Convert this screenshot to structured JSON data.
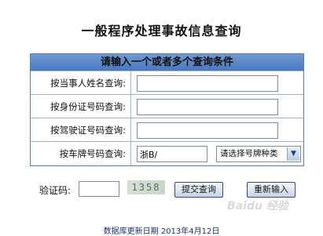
{
  "page": {
    "title": "一般程序处理事故信息查询"
  },
  "form": {
    "header": "请输入一个或者多个查询条件",
    "rows": [
      {
        "label": "按当事人姓名查询:",
        "value": ""
      },
      {
        "label": "按身份证号码查询:",
        "value": ""
      },
      {
        "label": "按驾驶证号码查询:",
        "value": ""
      },
      {
        "label": "按车牌号码查询:",
        "value": "浙B/",
        "select": "请选择号牌种类"
      }
    ]
  },
  "captcha": {
    "label": "验证码:",
    "value": "",
    "code": "1358"
  },
  "buttons": {
    "submit": "提交查询",
    "reset": "重新输入"
  },
  "footer": {
    "note": "数据库更新日期 2013年4月12日"
  },
  "watermark": {
    "text": "Baidu 经验"
  },
  "icons": {
    "select_arrow": "chevron-down-icon"
  },
  "colors": {
    "header_blue": "#4a78bd",
    "border_blue": "#5a7fb0",
    "footer_text": "#1c2f7a"
  }
}
